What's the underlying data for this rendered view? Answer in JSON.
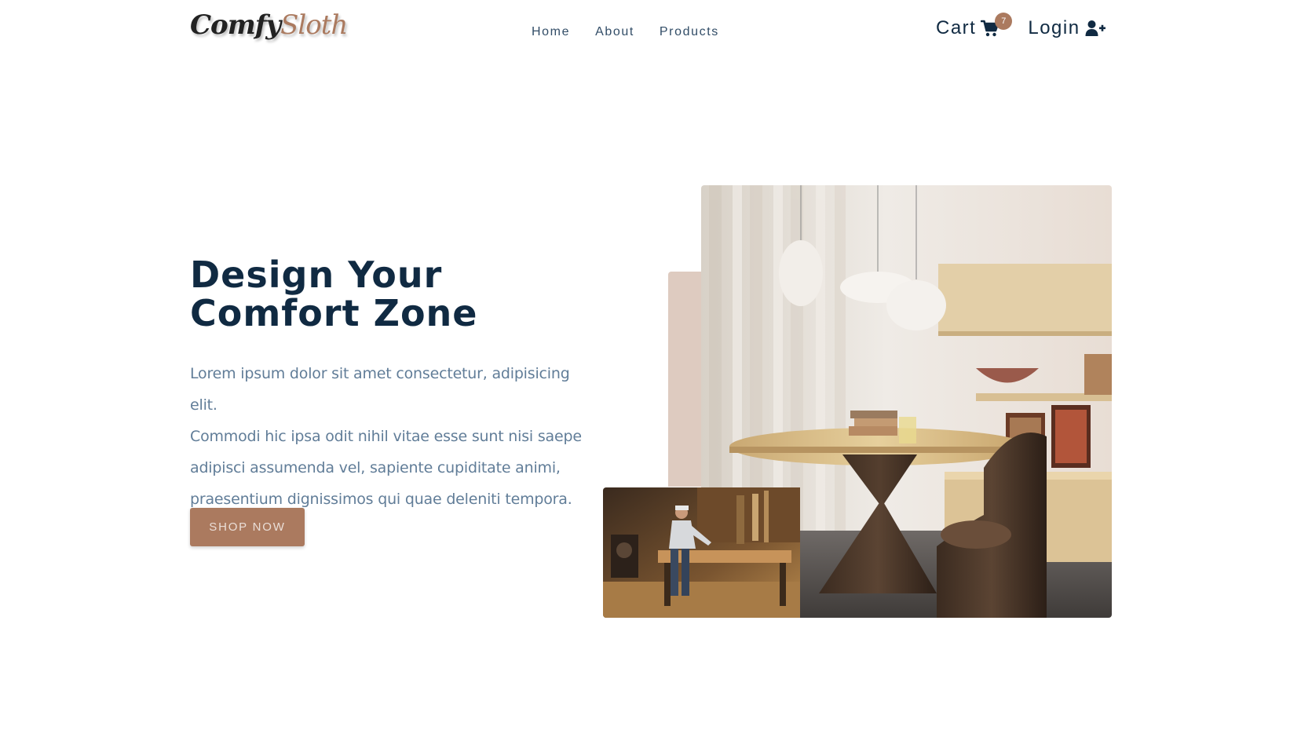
{
  "brand": {
    "name_part1": "Comfy",
    "name_part2": "Sloth"
  },
  "nav": {
    "links": [
      {
        "label": "Home"
      },
      {
        "label": "About"
      },
      {
        "label": "Products"
      }
    ]
  },
  "actions": {
    "cart_label": "Cart",
    "cart_count": "7",
    "login_label": "Login"
  },
  "hero": {
    "title_line1": "Design Your",
    "title_line2": "Comfort Zone",
    "text_line1": "Lorem ipsum dolor sit amet consectetur, adipisicing elit.",
    "text_line2": "Commodi hic ipsa odit nihil vitae esse sunt nisi saepe",
    "text_line3": "adipisci assumenda vel, sapiente cupiditate animi,",
    "text_line4": "praesentium dignissimos qui quae deleniti tempora.",
    "cta_label": "Shop Now"
  },
  "icons": {
    "cart": "cart-icon",
    "login": "user-plus-icon"
  },
  "colors": {
    "primary": "#ab7a5f",
    "heading": "#102a42",
    "body_text": "#617d98",
    "accent_block": "#decbc0"
  }
}
